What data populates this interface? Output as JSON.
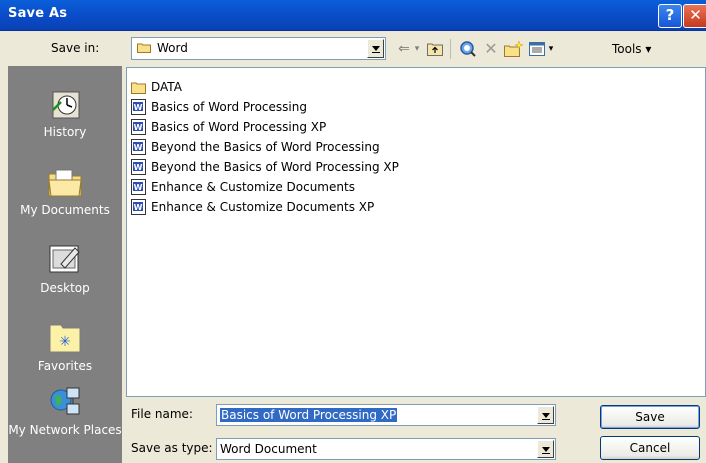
{
  "window": {
    "title": "Save As",
    "help_glyph": "?",
    "close_glyph": "✕"
  },
  "savein": {
    "label": "Save in:",
    "value": "Word"
  },
  "toolbar": {
    "tools_label": "Tools ▾"
  },
  "places": [
    {
      "label": "History",
      "icon": "history-icon"
    },
    {
      "label": "My Documents",
      "icon": "my-documents-icon"
    },
    {
      "label": "Desktop",
      "icon": "desktop-icon"
    },
    {
      "label": "Favorites",
      "icon": "favorites-icon"
    },
    {
      "label": "My Network Places",
      "icon": "network-places-icon"
    }
  ],
  "files": [
    {
      "name": "DATA",
      "type": "folder"
    },
    {
      "name": "Basics of Word Processing",
      "type": "word"
    },
    {
      "name": "Basics of Word Processing XP",
      "type": "word"
    },
    {
      "name": "Beyond the Basics of Word Processing",
      "type": "word"
    },
    {
      "name": "Beyond the Basics of Word Processing XP",
      "type": "word"
    },
    {
      "name": "Enhance & Customize Documents",
      "type": "word"
    },
    {
      "name": "Enhance & Customize Documents XP",
      "type": "word"
    }
  ],
  "form": {
    "filename_label": "File name:",
    "filename_value": "Basics of Word Processing XP",
    "filetype_label": "Save as type:",
    "filetype_value": "Word Document",
    "save_button": "Save",
    "cancel_button": "Cancel"
  }
}
